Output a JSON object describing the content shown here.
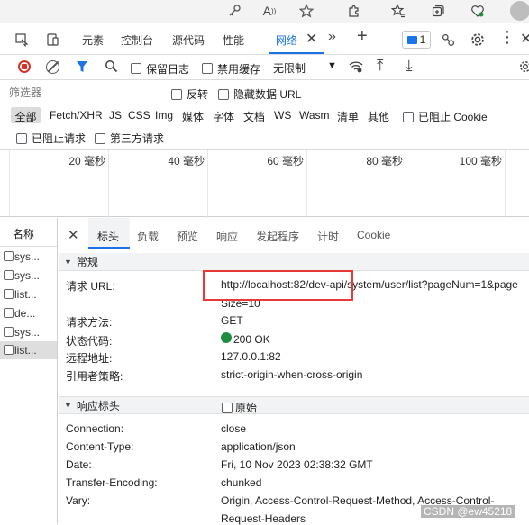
{
  "browser": {
    "icons": [
      "key-icon",
      "read-aloud-icon",
      "favorite-star-icon",
      "extensions-icon",
      "favorites-icon",
      "collections-icon",
      "browser-essentials-icon",
      "profile-avatar"
    ],
    "read_aloud_label": "A"
  },
  "devtools": {
    "tabs": [
      "元素",
      "控制台",
      "源代码",
      "性能",
      "网络"
    ],
    "active_tab": "网络",
    "issues_count": "1"
  },
  "toolbar": {
    "preserve_log": "保留日志",
    "disable_cache": "禁用缓存",
    "throttle": "无限制"
  },
  "filter": {
    "placeholder": "筛选器",
    "invert": "反转",
    "hide_data_urls": "隐藏数据 URL",
    "types": [
      "全部",
      "Fetch/XHR",
      "JS",
      "CSS",
      "Img",
      "媒体",
      "字体",
      "文档",
      "WS",
      "Wasm",
      "清单",
      "其他"
    ],
    "block_cookies": "已阻止 Cookie",
    "blocked_requests": "已阻止请求",
    "third_party": "第三方请求"
  },
  "timeline": {
    "labels": [
      "20 毫秒",
      "40 毫秒",
      "60 毫秒",
      "80 毫秒",
      "100 毫秒"
    ]
  },
  "requests": {
    "header": "名称",
    "items": [
      "sys...",
      "sys...",
      "list...",
      "de...",
      "sys...",
      "list..."
    ]
  },
  "details": {
    "tabs": [
      "标头",
      "负载",
      "预览",
      "响应",
      "发起程序",
      "计时",
      "Cookie"
    ],
    "active_tab": "标头",
    "general": {
      "title": "常规",
      "request_url_label": "请求 URL:",
      "request_url_line1": "http://localhost:82/dev-api/system/user/list?pageNum=1&page",
      "request_url_line2": "Size=10",
      "method_label": "请求方法:",
      "method": "GET",
      "status_label": "状态代码:",
      "status": "200 OK",
      "remote_label": "远程地址:",
      "remote": "127.0.0.1:82",
      "referrer_label": "引用者策略:",
      "referrer": "strict-origin-when-cross-origin"
    },
    "response_headers": {
      "title": "响应标头",
      "raw": "原始",
      "rows": [
        {
          "k": "Connection:",
          "v": "close"
        },
        {
          "k": "Content-Type:",
          "v": "application/json"
        },
        {
          "k": "Date:",
          "v": "Fri, 10 Nov 2023 02:38:32 GMT"
        },
        {
          "k": "Transfer-Encoding:",
          "v": "chunked"
        },
        {
          "k": "Vary:",
          "v": "Origin, Access-Control-Request-Method, Access-Control-"
        }
      ],
      "vary_cont": "Request-Headers"
    }
  },
  "watermark": "CSDN @ew45218",
  "colors": {
    "accent": "#1a73e8",
    "highlight_box": "#e53935",
    "status_ok": "#1e8e3e",
    "record": "#d93025"
  }
}
